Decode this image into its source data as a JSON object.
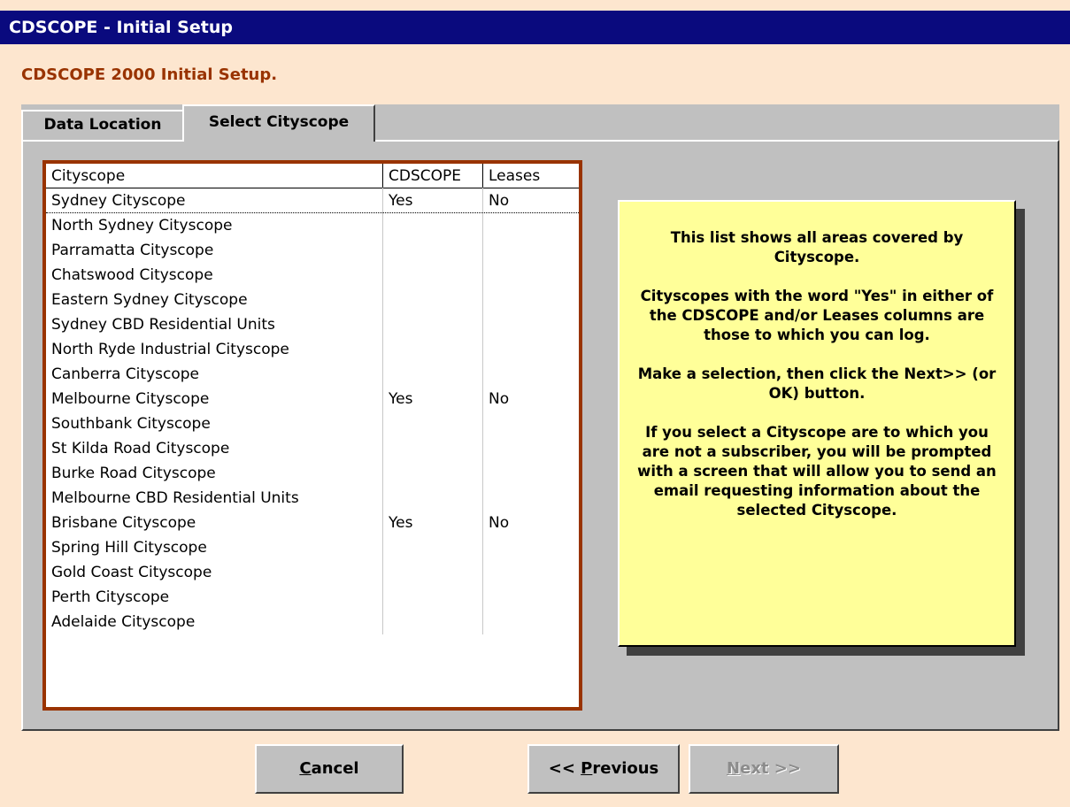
{
  "window": {
    "title": "CDSCOPE - Initial Setup"
  },
  "heading": "CDSCOPE 2000 Initial Setup.",
  "tabs": [
    {
      "label": "Data Location",
      "active": false
    },
    {
      "label": "Select Cityscope",
      "active": true
    }
  ],
  "list": {
    "columns": [
      "Cityscope",
      "CDSCOPE",
      "Leases"
    ],
    "rows": [
      {
        "name": "Sydney Cityscope",
        "cdscope": "Yes",
        "leases": "No",
        "selected": true
      },
      {
        "name": "North Sydney Cityscope",
        "cdscope": "",
        "leases": ""
      },
      {
        "name": "Parramatta Cityscope",
        "cdscope": "",
        "leases": ""
      },
      {
        "name": "Chatswood Cityscope",
        "cdscope": "",
        "leases": ""
      },
      {
        "name": "Eastern Sydney Cityscope",
        "cdscope": "",
        "leases": ""
      },
      {
        "name": "Sydney CBD Residential Units",
        "cdscope": "",
        "leases": ""
      },
      {
        "name": "North Ryde Industrial Cityscope",
        "cdscope": "",
        "leases": ""
      },
      {
        "name": "Canberra Cityscope",
        "cdscope": "",
        "leases": ""
      },
      {
        "name": "Melbourne Cityscope",
        "cdscope": "Yes",
        "leases": "No"
      },
      {
        "name": "Southbank Cityscope",
        "cdscope": "",
        "leases": ""
      },
      {
        "name": "St Kilda Road Cityscope",
        "cdscope": "",
        "leases": ""
      },
      {
        "name": "Burke Road Cityscope",
        "cdscope": "",
        "leases": ""
      },
      {
        "name": "Melbourne CBD Residential Units",
        "cdscope": "",
        "leases": ""
      },
      {
        "name": "Brisbane Cityscope",
        "cdscope": "Yes",
        "leases": "No"
      },
      {
        "name": "Spring Hill Cityscope",
        "cdscope": "",
        "leases": ""
      },
      {
        "name": "Gold Coast Cityscope",
        "cdscope": "",
        "leases": ""
      },
      {
        "name": "Perth Cityscope",
        "cdscope": "",
        "leases": ""
      },
      {
        "name": "Adelaide Cityscope",
        "cdscope": "",
        "leases": ""
      }
    ]
  },
  "info": {
    "p1": "This list shows all areas covered by Cityscope.",
    "p2": "Cityscopes with the word \"Yes\" in either of the CDSCOPE and/or Leases columns are those to which you can log.",
    "p3": "Make a selection, then click the Next>> (or OK) button.",
    "p4": "If you select a Cityscope are to which you are not a subscriber, you will be prompted with a screen that will allow you to send an email requesting information about the selected Cityscope."
  },
  "buttons": {
    "cancel": {
      "accel": "C",
      "rest": "ancel"
    },
    "previous": {
      "prefix": "<< ",
      "accel": "P",
      "rest": "revious"
    },
    "next": {
      "accel": "N",
      "rest": "ext >>",
      "enabled": false
    }
  },
  "colors": {
    "background": "#fde6cf",
    "titlebar": "#0a0a7e",
    "accent": "#993300",
    "panel": "#c0c0c0",
    "info": "#ffff99"
  }
}
